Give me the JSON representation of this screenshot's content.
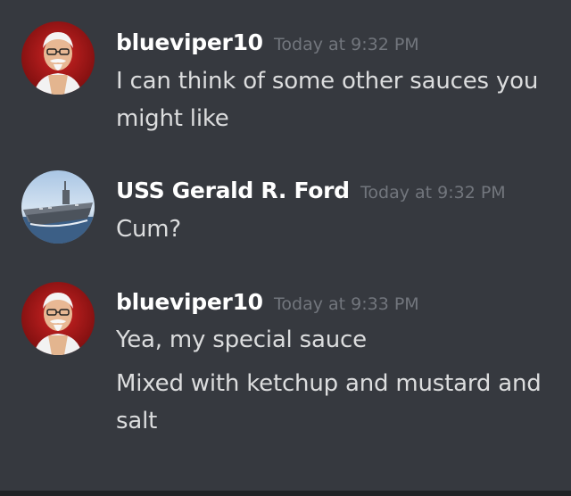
{
  "messages": [
    {
      "author": "blueviper10",
      "timestamp": "Today at 9:32 PM",
      "avatar_icon": "colonel-avatar-icon",
      "lines": [
        "I can think of some other sauces you might like"
      ]
    },
    {
      "author": "USS Gerald R. Ford",
      "timestamp": "Today at 9:32 PM",
      "avatar_icon": "aircraft-carrier-avatar-icon",
      "lines": [
        "Cum?"
      ]
    },
    {
      "author": "blueviper10",
      "timestamp": "Today at 9:33 PM",
      "avatar_icon": "colonel-avatar-icon",
      "lines": [
        "Yea, my special sauce",
        "Mixed with ketchup and mustard and salt"
      ]
    }
  ],
  "colors": {
    "background": "#36393f",
    "username": "#ffffff",
    "message_text": "#dcddde",
    "timestamp": "#72767d"
  }
}
